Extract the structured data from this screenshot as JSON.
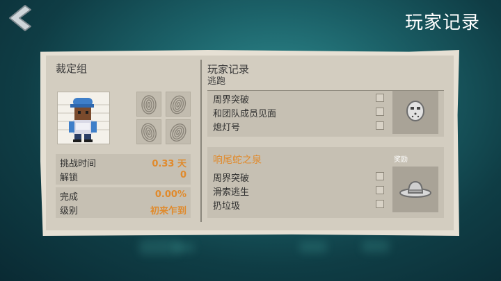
{
  "header": {
    "title": "玩家记录",
    "back_icon": "back-chevron-icon"
  },
  "left_panel": {
    "title": "裁定组",
    "portrait_icon": "inmate-portrait-icon",
    "fingerprint_icon": "fingerprint-icon",
    "stats": [
      {
        "label": "挑战时间",
        "value": "0.33 天"
      },
      {
        "label": "解锁",
        "value": "0"
      },
      {
        "label": "完成",
        "value": "0.00%"
      },
      {
        "label": "级别",
        "value": "初来乍到"
      }
    ]
  },
  "right_panel": {
    "title": "玩家记录",
    "subtitle": "逃跑",
    "challenges": [
      {
        "name": "",
        "objectives": [
          "周界突破",
          "和团队成员见面",
          "熄灯号"
        ],
        "reward_label": "",
        "reward_icon": "hockey-mask-icon"
      },
      {
        "name": "响尾蛇之泉",
        "objectives": [
          "周界突破",
          "滑索逃生",
          "扔垃圾"
        ],
        "reward_label": "奖励",
        "reward_icon": "cowboy-hat-icon"
      }
    ]
  },
  "colors": {
    "accent": "#e08a2c",
    "paper": "#e6e0d4",
    "panel": "#c6c0b3",
    "background": "#1b6067"
  }
}
